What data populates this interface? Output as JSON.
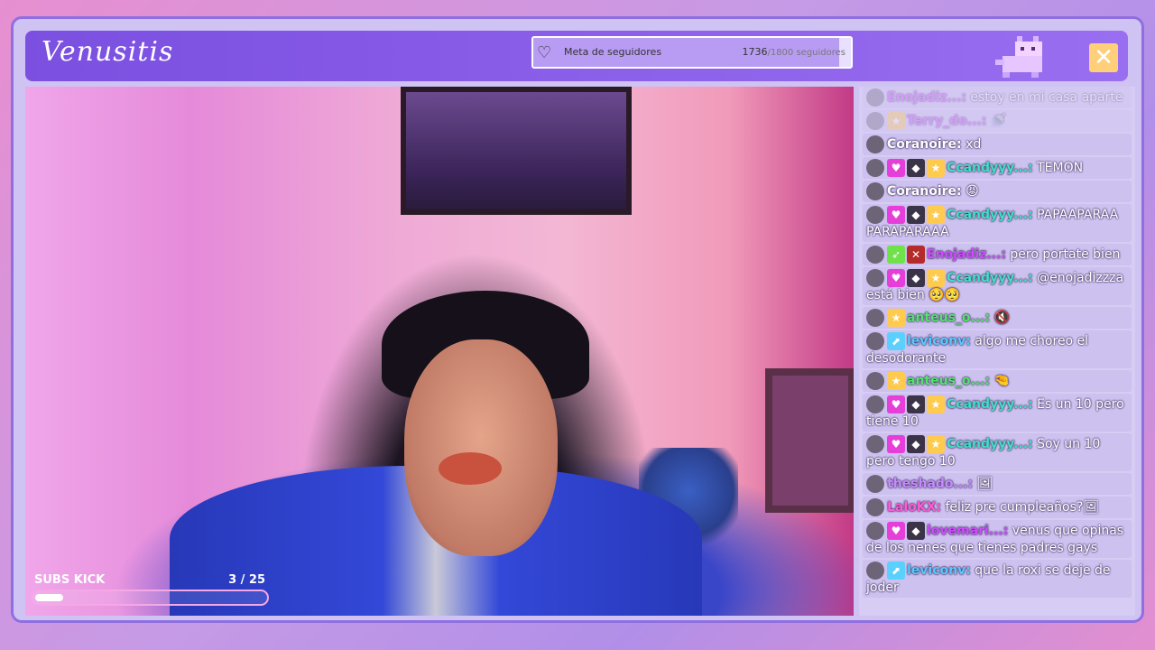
{
  "header": {
    "logo": "Venusitis",
    "goal": {
      "label": "Meta de seguidores",
      "current": "1736",
      "max": "/1800 seguidores",
      "progress": 0.964
    },
    "close_label": "✕"
  },
  "subs": {
    "label": "SUBS KICK",
    "count": "3   / 25",
    "progress": 0.12
  },
  "chat": [
    {
      "user": "Enojadiz...:",
      "color": "u-violet",
      "badges": [],
      "text": "estoy en mi casa aparte",
      "faded": true
    },
    {
      "user": "Terry_do...:",
      "color": "u-violet",
      "badges": [
        "star"
      ],
      "text": "🚿",
      "faded": true
    },
    {
      "user": "Coranoire:",
      "color": "u-gray",
      "badges": [],
      "text": "xd",
      "faded": false
    },
    {
      "user": "Ccandyyy...:",
      "color": "u-teal",
      "badges": [
        "heart",
        "gray",
        "star"
      ],
      "text": "TEMON",
      "faded": false
    },
    {
      "user": "Coranoire:",
      "color": "u-gray",
      "badges": [],
      "text": "😡",
      "faded": false
    },
    {
      "user": "Ccandyyy...:",
      "color": "u-teal",
      "badges": [
        "heart",
        "gray",
        "star"
      ],
      "text": "PAPAAPARAA PARAPARAAA",
      "faded": false
    },
    {
      "user": "Enojadiz...:",
      "color": "u-violet",
      "badges": [
        "green",
        "red"
      ],
      "text": "pero portate bien",
      "faded": false
    },
    {
      "user": "Ccandyyy...:",
      "color": "u-teal",
      "badges": [
        "heart",
        "gray",
        "star"
      ],
      "text": "@enojadizzza está bien 🥺🥺",
      "faded": false
    },
    {
      "user": "anteus_o...:",
      "color": "u-green",
      "badges": [
        "star"
      ],
      "text": "🔇",
      "faded": false
    },
    {
      "user": "leviconv:",
      "color": "u-cyan",
      "badges": [
        "blue"
      ],
      "text": "algo me choreo el desodorante",
      "faded": false
    },
    {
      "user": "anteus_o...:",
      "color": "u-green",
      "badges": [
        "star"
      ],
      "text": "🤏",
      "faded": false
    },
    {
      "user": "Ccandyyy...:",
      "color": "u-teal",
      "badges": [
        "heart",
        "gray",
        "star"
      ],
      "text": "Es un 10 pero tiene 10",
      "faded": false
    },
    {
      "user": "Ccandyyy...:",
      "color": "u-teal",
      "badges": [
        "heart",
        "gray",
        "star"
      ],
      "text": "Soy un 10 pero tengo 10",
      "faded": false
    },
    {
      "user": "theshado...:",
      "color": "u-lilac",
      "badges": [],
      "text": "🖼",
      "faded": false
    },
    {
      "user": "LaloKX:",
      "color": "u-pink",
      "badges": [],
      "text": "feliz pre cumpleaños?🖼",
      "faded": false
    },
    {
      "user": "lovemari...:",
      "color": "u-violet",
      "badges": [
        "heart",
        "gray"
      ],
      "text": "venus que opinas de los nenes que tienes padres gays",
      "faded": false
    },
    {
      "user": "leviconv:",
      "color": "u-cyan",
      "badges": [
        "blue"
      ],
      "text": "que la roxi se deje de joder",
      "faded": false
    }
  ],
  "colors": {
    "header_bg": "#7b4fe0",
    "frame_bg": "#cfc3f3",
    "close_btn": "#ffcf7a",
    "accent_pink": "#f4a8e6"
  }
}
